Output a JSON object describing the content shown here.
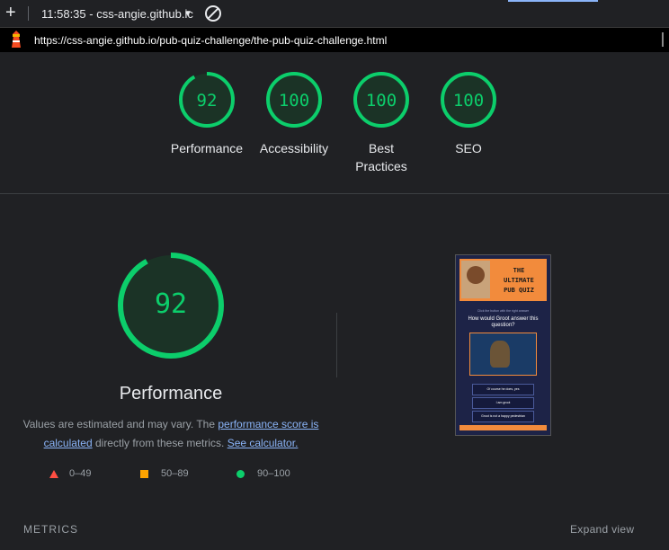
{
  "browser": {
    "tab_title": "11:58:35 - css-angie.github.ic",
    "url": "https://css-angie.github.io/pub-quiz-challenge/the-pub-quiz-challenge.html"
  },
  "summary_gauges": [
    {
      "score": "92",
      "label": "Performance"
    },
    {
      "score": "100",
      "label": "Accessibility"
    },
    {
      "score": "100",
      "label": "Best Practices"
    },
    {
      "score": "100",
      "label": "SEO"
    }
  ],
  "performance": {
    "score": "92",
    "score_fraction": 0.92,
    "title": "Performance",
    "desc_prefix": "Values are estimated and may vary. The ",
    "desc_link1": "performance score is calculated",
    "desc_middle": " directly from these metrics. ",
    "desc_link2": "See calculator."
  },
  "legend": [
    {
      "range": "0–49",
      "shape": "triangle",
      "color": "#ff4e42"
    },
    {
      "range": "50–89",
      "shape": "square",
      "color": "#ffa400"
    },
    {
      "range": "90–100",
      "shape": "circle",
      "color": "#0cce6b"
    }
  ],
  "screenshot": {
    "title_line1": "THE",
    "title_line2": "ULTIMATE",
    "title_line3": "PUB QUIZ",
    "instruction": "Click the button with the right answer",
    "question": "How would Groot answer this question?",
    "options": [
      "Of course he does, yes",
      "I am groot",
      "Groot is not a happy pedestrian"
    ]
  },
  "footer": {
    "metrics_label": "METRICS",
    "expand_label": "Expand view"
  },
  "colors": {
    "pass": "#0cce6b",
    "link": "#8ab4f8",
    "background": "#202124"
  }
}
